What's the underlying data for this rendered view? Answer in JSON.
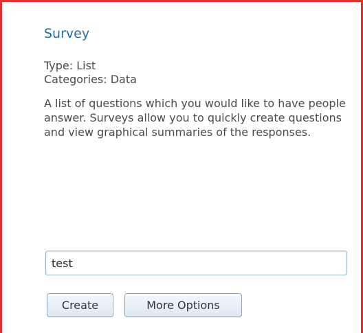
{
  "template": {
    "title": "Survey",
    "type_line": "Type: List",
    "categories_line": "Categories: Data",
    "description": "A list of questions which you would like to have people answer.  Surveys allow you to quickly create questions and view graphical summaries of the responses."
  },
  "form": {
    "name_value": "test"
  },
  "buttons": {
    "create_label": "Create",
    "more_options_label": "More Options"
  },
  "colors": {
    "frame_border": "#e03030",
    "title": "#1f6fa6"
  }
}
